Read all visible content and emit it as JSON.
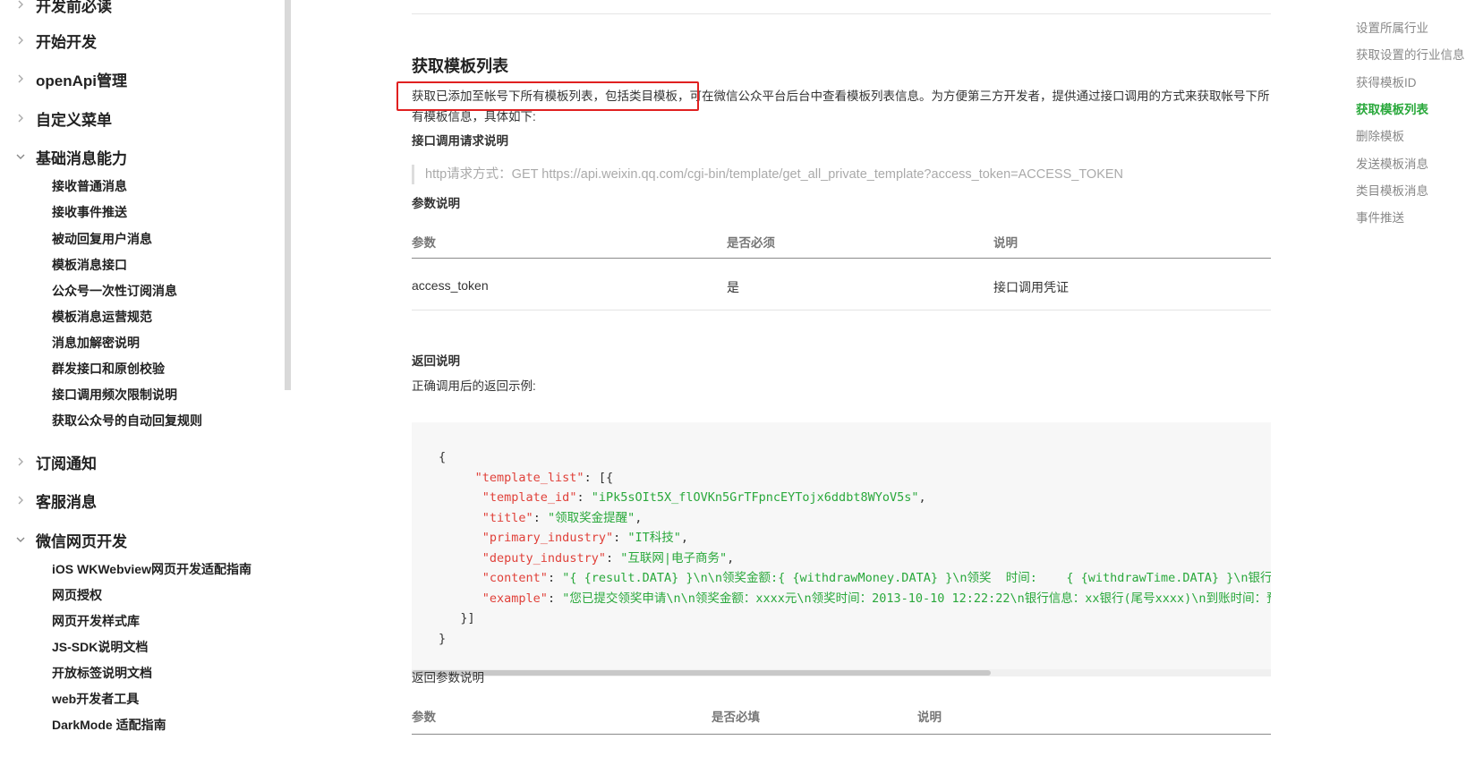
{
  "sidebar": {
    "groups": [
      {
        "label": "开发前必读",
        "expanded": false
      },
      {
        "label": "开始开发",
        "expanded": false
      },
      {
        "label": "openApi管理",
        "expanded": false
      },
      {
        "label": "自定义菜单",
        "expanded": false
      },
      {
        "label": "基础消息能力",
        "expanded": true
      },
      {
        "label": "订阅通知",
        "expanded": false
      },
      {
        "label": "客服消息",
        "expanded": false
      },
      {
        "label": "微信网页开发",
        "expanded": true
      }
    ],
    "basic_items": [
      "接收普通消息",
      "接收事件推送",
      "被动回复用户消息",
      "模板消息接口",
      "公众号一次性订阅消息",
      "模板消息运营规范",
      "消息加解密说明",
      "群发接口和原创校验",
      "接口调用频次限制说明",
      "获取公众号的自动回复规则"
    ],
    "web_items": [
      "iOS WKWebview网页开发适配指南",
      "网页授权",
      "网页开发样式库",
      "JS-SDK说明文档",
      "开放标签说明文档",
      "web开发者工具",
      "DarkMode 适配指南"
    ]
  },
  "content": {
    "title": "获取模板列表",
    "intro": "获取已添加至帐号下所有模板列表，包括类目模板，可在微信公众平台后台中查看模板列表信息。为方便第三方开发者，提供通过接口调用的方式来获取帐号下所有模板信息，具体如下:",
    "request_title": "接口调用请求说明",
    "request_line": "http请求方式：GET https://api.weixin.qq.com/cgi-bin/template/get_all_private_template?access_token=ACCESS_TOKEN",
    "params_title": "参数说明",
    "params_table": {
      "headers": [
        "参数",
        "是否必须",
        "说明"
      ],
      "rows": [
        [
          "access_token",
          "是",
          "接口调用凭证"
        ]
      ]
    },
    "return_title": "返回说明",
    "return_example_label": "正确调用后的返回示例:",
    "code": {
      "open_brace": "{",
      "list_key": "\"template_list\"",
      "list_open": ": [{",
      "fields": [
        {
          "key": "\"template_id\"",
          "value": "\"iPk5sOIt5X_flOVKn5GrTFpncEYTojx6ddbt8WYoV5s\"",
          "tail": ","
        },
        {
          "key": "\"title\"",
          "value": "\"领取奖金提醒\"",
          "tail": ","
        },
        {
          "key": "\"primary_industry\"",
          "value": "\"IT科技\"",
          "tail": ","
        },
        {
          "key": "\"deputy_industry\"",
          "value": "\"互联网|电子商务\"",
          "tail": ","
        },
        {
          "key": "\"content\"",
          "value": "\"{ {result.DATA} }\\n\\n领奖金额:{ {withdrawMoney.DATA} }\\n领奖  时间:    { {withdrawTime.DATA} }\\n银行信息:",
          "tail": ""
        },
        {
          "key": "\"example\"",
          "value": "\"您已提交领奖申请\\n\\n领奖金额：xxxx元\\n领奖时间：2013-10-10 12:22:22\\n银行信息：xx银行(尾号xxxx)\\n到账时间：预",
          "tail": ""
        }
      ],
      "list_close": "}]",
      "close_brace": "}"
    },
    "return_params_title": "返回参数说明",
    "return_params_headers": [
      "参数",
      "是否必填",
      "说明"
    ]
  },
  "toc": {
    "items": [
      "设置所属行业",
      "获取设置的行业信息",
      "获得模板ID",
      "获取模板列表",
      "删除模板",
      "发送模板消息",
      "类目模板消息",
      "事件推送"
    ],
    "active_index": 3
  },
  "colors": {
    "accent_green": "#29a83b",
    "highlight_red": "#e02020",
    "code_key": "#e0413a",
    "code_string": "#29a83b"
  }
}
